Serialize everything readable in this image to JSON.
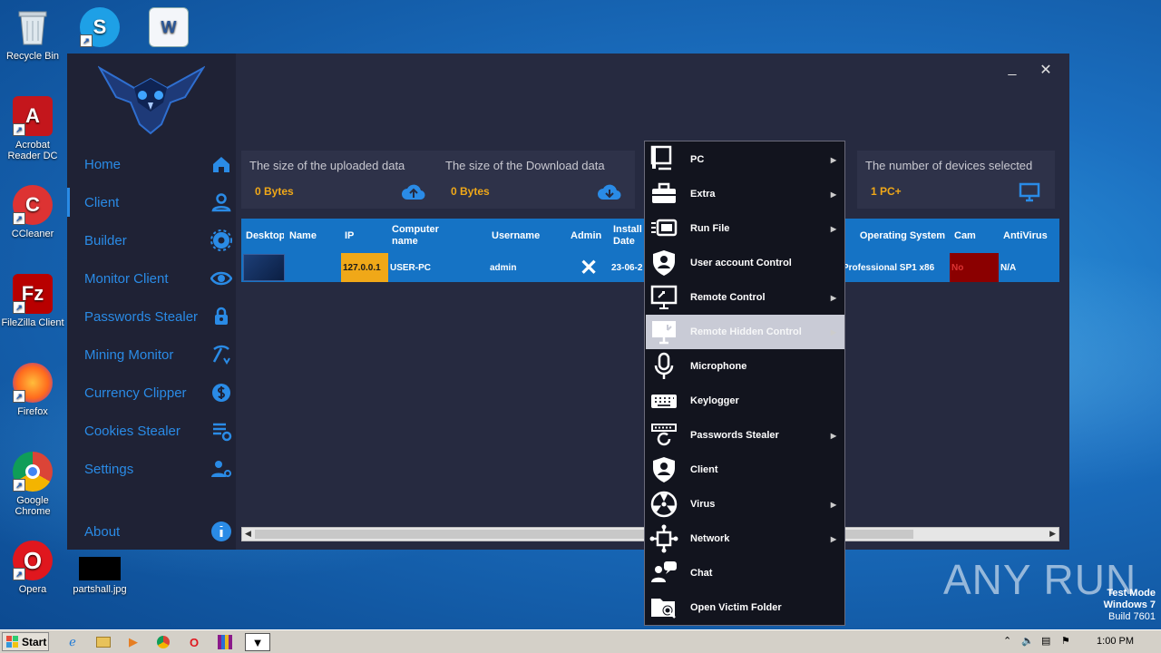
{
  "desktop": {
    "icons": [
      {
        "label": "Recycle Bin",
        "icon": "recycle-bin-icon"
      },
      {
        "label": "",
        "icon": "skype-icon"
      },
      {
        "label": "",
        "icon": "word-document-icon"
      },
      {
        "label": "Acrobat Reader DC",
        "icon": "acrobat-icon"
      },
      {
        "label": "CCleaner",
        "icon": "ccleaner-icon"
      },
      {
        "label": "FileZilla Client",
        "icon": "filezilla-icon"
      },
      {
        "label": "Firefox",
        "icon": "firefox-icon"
      },
      {
        "label": "Google Chrome",
        "icon": "chrome-icon"
      },
      {
        "label": "Opera",
        "icon": "opera-icon"
      },
      {
        "label": "partshall.jpg",
        "icon": "image-file-icon"
      }
    ],
    "watermark": {
      "line1": "Test Mode",
      "line2": "Windows 7",
      "line3": "Build 7601"
    },
    "anyrun": "ANY RUN"
  },
  "app": {
    "window_controls": {
      "minimize": "_",
      "close": "✕"
    },
    "nav": [
      {
        "label": "Home",
        "icon": "home-icon"
      },
      {
        "label": "Client",
        "icon": "user-icon",
        "active": true
      },
      {
        "label": "Builder",
        "icon": "gear-icon"
      },
      {
        "label": "Monitor Client",
        "icon": "eye-icon"
      },
      {
        "label": "Passwords Stealer",
        "icon": "lock-icon"
      },
      {
        "label": "Mining Monitor",
        "icon": "pickaxe-icon"
      },
      {
        "label": "Currency Clipper",
        "icon": "currency-icon"
      },
      {
        "label": "Cookies Stealer",
        "icon": "cookies-icon"
      },
      {
        "label": "Settings",
        "icon": "user-settings-icon"
      },
      {
        "label": "About",
        "icon": "info-icon"
      }
    ],
    "stats": [
      {
        "title": "The size of the uploaded data",
        "value": "0 Bytes",
        "icon": "cloud-upload-icon"
      },
      {
        "title": "The size of the Download data",
        "value": "0 Bytes",
        "icon": "cloud-download-icon"
      },
      {
        "title": "The number of devices selected",
        "value": "1 PC+",
        "icon": "monitor-icon"
      }
    ],
    "grid": {
      "columns": [
        "Desktop",
        "Name",
        "IP",
        "Computer name",
        "Username",
        "Admin",
        "Install Date",
        "Operating System",
        "Cam",
        "AntiVirus"
      ],
      "row": {
        "name": "",
        "ip": "127.0.0.1",
        "computer_name": "USER-PC",
        "username": "admin",
        "admin": "✕",
        "install_date": "23-06-2",
        "os": "Professional SP1 x86",
        "cam": "No",
        "antivirus": "N/A"
      }
    },
    "colors": {
      "accent": "#2a8be6",
      "header": "#1573c5",
      "ip_bg": "#f0a818",
      "cam_bg": "#8b0000",
      "value": "#f0a818"
    }
  },
  "context_menu": {
    "items": [
      {
        "label": "PC",
        "icon": "pc-icon",
        "submenu": true
      },
      {
        "label": "Extra",
        "icon": "toolbox-icon",
        "submenu": true
      },
      {
        "label": "Run File",
        "icon": "run-file-icon",
        "submenu": true
      },
      {
        "label": "User account Control",
        "icon": "shield-user-icon",
        "submenu": false
      },
      {
        "label": "Remote Control",
        "icon": "remote-control-icon",
        "submenu": true
      },
      {
        "label": "Remote Hidden Control",
        "icon": "remote-hidden-icon",
        "submenu": true,
        "highlighted": true
      },
      {
        "label": "Microphone",
        "icon": "microphone-icon",
        "submenu": false
      },
      {
        "label": "Keylogger",
        "icon": "keyboard-icon",
        "submenu": false
      },
      {
        "label": "Passwords Stealer",
        "icon": "password-icon",
        "submenu": true
      },
      {
        "label": "Client",
        "icon": "client-shield-icon",
        "submenu": false
      },
      {
        "label": "Virus",
        "icon": "radiation-icon",
        "submenu": true
      },
      {
        "label": "Network",
        "icon": "network-icon",
        "submenu": true
      },
      {
        "label": "Chat",
        "icon": "chat-icon",
        "submenu": false
      },
      {
        "label": "Open Victim Folder",
        "icon": "folder-search-icon",
        "submenu": false
      }
    ]
  },
  "taskbar": {
    "start": "Start",
    "clock": "1:00 PM",
    "apps": [
      "ie-icon",
      "explorer-icon",
      "media-player-icon",
      "chrome-icon",
      "opera-icon",
      "winrar-icon",
      "app-window-icon"
    ]
  }
}
